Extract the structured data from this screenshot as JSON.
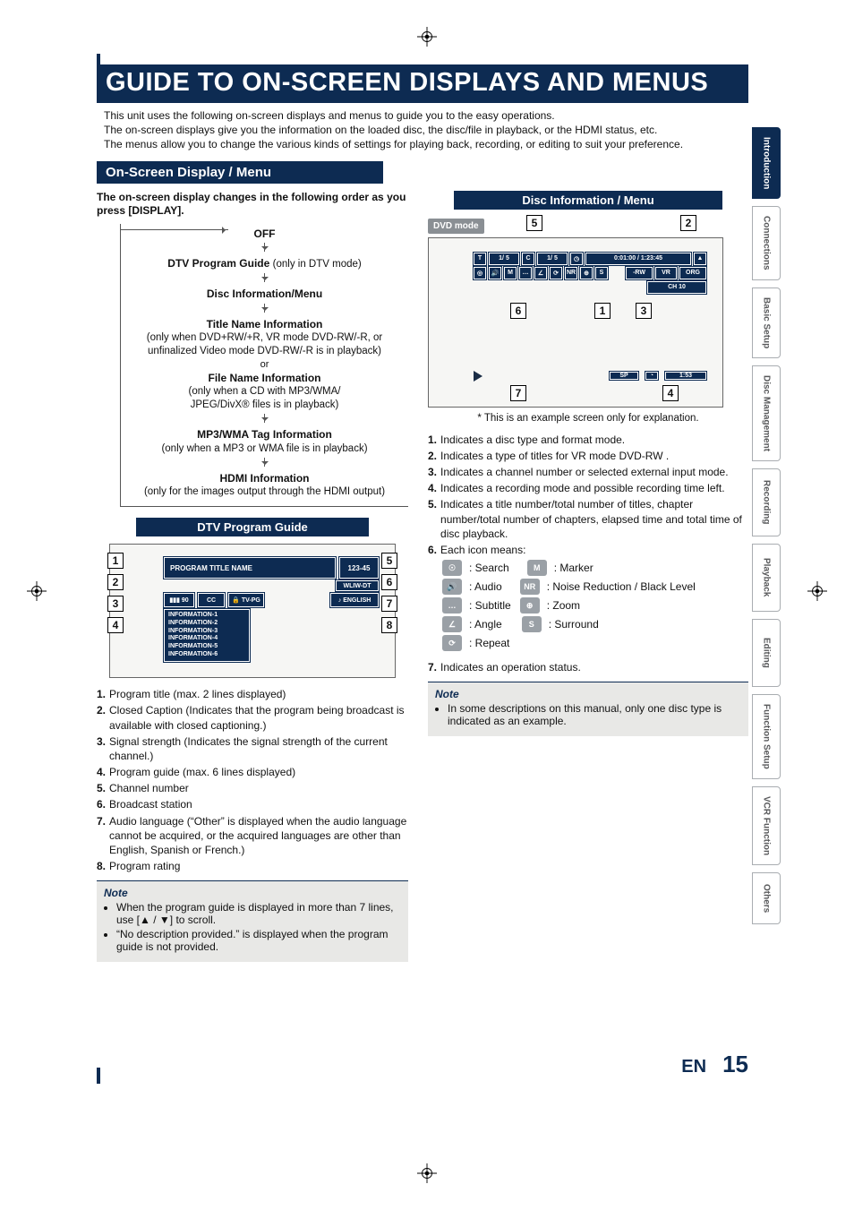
{
  "meta": {
    "lang_code": "EN",
    "page_number": "15"
  },
  "tabs": [
    "Introduction",
    "Connections",
    "Basic Setup",
    "Disc\nManagement",
    "Recording",
    "Playback",
    "Editing",
    "Function Setup",
    "VCR Function",
    "Others"
  ],
  "title": "GUIDE TO ON-SCREEN DISPLAYS AND MENUS",
  "intro": "This unit uses the following on-screen displays and menus to guide you to the easy operations.\nThe on-screen displays give you the information on the loaded disc, the disc/file in playback, or the HDMI status, etc.\nThe menus allow you to change the various kinds of settings for playing back, recording, or editing to suit your preference.",
  "section_band": "On-Screen Display / Menu",
  "flow_intro": "The on-screen display changes in the following order as you press [DISPLAY].",
  "flow": [
    {
      "head": "OFF",
      "sub": ""
    },
    {
      "head": "DTV Program Guide",
      "sub": "(only in DTV mode)"
    },
    {
      "head": "Disc Information/Menu",
      "sub": ""
    },
    {
      "head": "Title Name Information",
      "sub": "(only when DVD+RW/+R, VR mode DVD-RW/-R, or unfinalized Video mode DVD-RW/-R is in playback)"
    },
    {
      "or": "or"
    },
    {
      "head": "File Name Information",
      "sub": "(only when a CD with MP3/WMA/\nJPEG/DivX® files is in playback)"
    },
    {
      "head": "MP3/WMA Tag Information",
      "sub": "(only when a MP3 or WMA file is in playback)"
    },
    {
      "head": "HDMI Information",
      "sub": "(only for the images output through the HDMI output)"
    }
  ],
  "dtv": {
    "panel_title": "DTV Program Guide",
    "program_title": "PROGRAM TITLE NAME",
    "channel": "123-45",
    "station": "WLIW-DT",
    "signal": "90",
    "cc": "CC",
    "rating": "TV-PG",
    "lang": "ENGLISH",
    "info": [
      "INFORMATION-1",
      "INFORMATION-2",
      "INFORMATION-3",
      "INFORMATION-4",
      "INFORMATION-5",
      "INFORMATION-6"
    ],
    "callouts": [
      "1",
      "2",
      "3",
      "4",
      "5",
      "6",
      "7",
      "8"
    ],
    "list": [
      "Program title (max. 2 lines displayed)",
      "Closed Caption (Indicates that the program being broadcast is available with closed captioning.)",
      "Signal strength (Indicates the signal strength of the current channel.)",
      "Program guide (max. 6 lines displayed)",
      "Channel number",
      "Broadcast station",
      "Audio language (“Other” is displayed when the audio language cannot be acquired, or the acquired languages are other than English, Spanish or French.)",
      "Program rating"
    ],
    "note_title": "Note",
    "notes": [
      "When the program guide is displayed in more than 7 lines, use [▲ / ▼] to scroll.",
      "“No description provided.” is displayed when the program guide is not provided."
    ]
  },
  "disc": {
    "panel_title": "Disc Information / Menu",
    "badge": "DVD mode",
    "t_label": "T",
    "t_val": "1/  5",
    "c_label": "C",
    "c_val": "1/  5",
    "time": "0:01:00 / 1:23:45",
    "fmt": [
      "-RW",
      "VR",
      "ORG"
    ],
    "ch": "CH   10",
    "sp": "SP",
    "time_left": "1:53",
    "callouts": [
      "5",
      "2",
      "6",
      "1",
      "3",
      "7",
      "4"
    ],
    "asterisk": "* This is an example screen only for explanation.",
    "list": [
      "Indicates a disc type and format mode.",
      "Indicates a type of titles for VR mode DVD-RW .",
      "Indicates a channel number or selected external input mode.",
      "Indicates a recording mode and possible recording time left.",
      "Indicates a title number/total number of titles, chapter number/total number of chapters, elapsed time and total time of disc playback.",
      "Each icon means:"
    ],
    "legend": [
      {
        "l": "☉",
        "ll": ": Search",
        "r": "M",
        "rl": ": Marker"
      },
      {
        "l": "🔊",
        "ll": ": Audio",
        "r": "NR",
        "rl": ": Noise Reduction / Black Level"
      },
      {
        "l": "…",
        "ll": ": Subtitle",
        "r": "⊕",
        "rl": ": Zoom"
      },
      {
        "l": "∠",
        "ll": ": Angle",
        "r": "S",
        "rl": ": Surround"
      },
      {
        "l": "⟳",
        "ll": ": Repeat",
        "r": "",
        "rl": ""
      }
    ],
    "item7": "Indicates an operation status.",
    "note_title": "Note",
    "notes": [
      "In some descriptions on this manual, only one disc type is indicated as an example."
    ]
  }
}
